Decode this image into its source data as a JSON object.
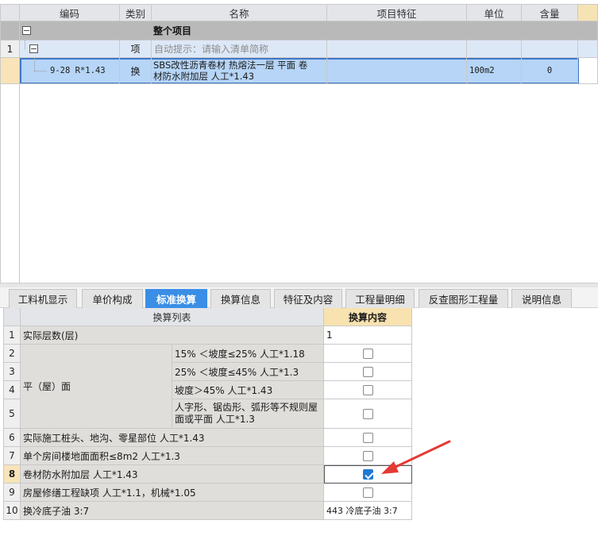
{
  "top_grid": {
    "columns": [
      "编码",
      "类别",
      "名称",
      "项目特征",
      "单位",
      "含量"
    ],
    "group_row": {
      "name": "整个项目"
    },
    "row1": {
      "index": "1",
      "category": "项",
      "name": "自动提示：请输入清单简称"
    },
    "row2": {
      "code": "9-28 R*1.43",
      "category": "换",
      "name_line1": "SBS改性沥青卷材 热熔法一层 平面  卷",
      "name_line2": "材防水附加层 人工*1.43",
      "unit": "100m2",
      "amount": "0"
    }
  },
  "tabs": [
    {
      "label": "工料机显示",
      "active": false
    },
    {
      "label": "单价构成",
      "active": false
    },
    {
      "label": "标准换算",
      "active": true
    },
    {
      "label": "换算信息",
      "active": false
    },
    {
      "label": "特征及内容",
      "active": false
    },
    {
      "label": "工程量明细",
      "active": false
    },
    {
      "label": "反查图形工程量",
      "active": false
    },
    {
      "label": "说明信息",
      "active": false
    }
  ],
  "conversion_table": {
    "col_list": "换算列表",
    "col_content": "换算内容",
    "row1": {
      "index": "1",
      "label": "实际层数(层)",
      "value": "1"
    },
    "group_label": "平（屋）面",
    "row2": {
      "index": "2",
      "label": "15% ＜坡度≤25% 人工*1.18",
      "checked": false
    },
    "row3": {
      "index": "3",
      "label": "25% ＜坡度≤45% 人工*1.3",
      "checked": false
    },
    "row4": {
      "index": "4",
      "label": "坡度＞45% 人工*1.43",
      "checked": false
    },
    "row5": {
      "index": "5",
      "label_line1": "人字形、锯齿形、弧形等不规则屋",
      "label_line2": "面或平面 人工*1.3",
      "checked": false
    },
    "row6": {
      "index": "6",
      "label": "实际施工桩头、地沟、零星部位 人工*1.43",
      "checked": false
    },
    "row7": {
      "index": "7",
      "label": "单个房间楼地面面积≤8m2 人工*1.3",
      "checked": false
    },
    "row8": {
      "index": "8",
      "label": "卷材防水附加层 人工*1.43",
      "checked": true
    },
    "row9": {
      "index": "9",
      "label": "房屋修缮工程缺项 人工*1.1，机械*1.05",
      "checked": false
    },
    "row10": {
      "index": "10",
      "label": "换冷底子油 3:7",
      "value": "443  冷底子油 3:7"
    }
  },
  "colors": {
    "accent_tab": "#3a8ee6",
    "selected_row": "#b6d5f7",
    "arrow": "#e53935"
  }
}
